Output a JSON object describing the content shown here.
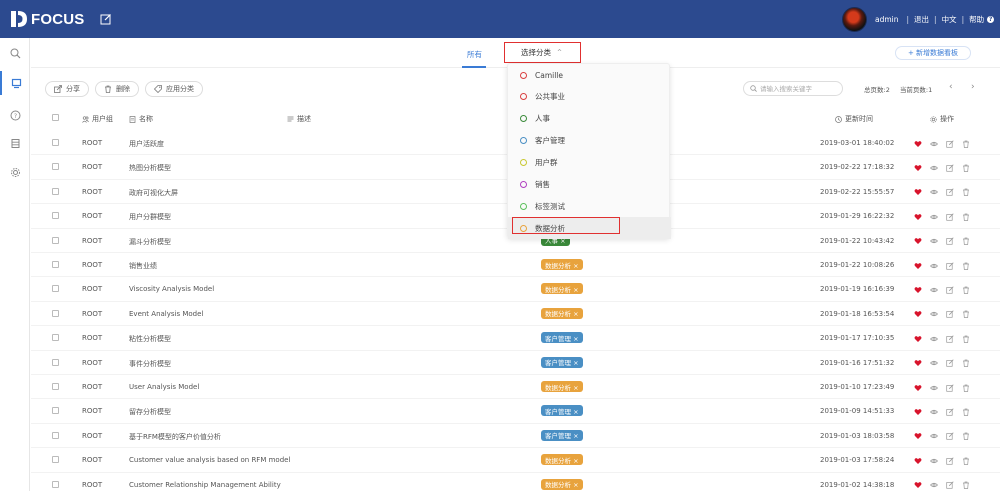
{
  "header": {
    "logo_text": "FOCUS",
    "user": "admin",
    "logout": "退出",
    "lang": "中文",
    "help": "帮助",
    "sep": "|"
  },
  "tabs": {
    "all": "所有",
    "select_category": "选择分类",
    "new_board": "+ 新增数据看板"
  },
  "actions": {
    "share": "分享",
    "delete": "删除",
    "apply_category": "应用分类"
  },
  "search": {
    "placeholder": "请输入搜索关键字"
  },
  "pager": {
    "total": "总页数:2",
    "current": "当前页数:1"
  },
  "table": {
    "headers": {
      "group": "用户组",
      "name": "名称",
      "desc": "描述",
      "updated": "更新时间",
      "ops": "操作"
    },
    "rows": [
      {
        "group": "ROOT",
        "name": "用户活跃度",
        "tag": "",
        "tag_color": "",
        "time": "2019-03-01 18:40:02"
      },
      {
        "group": "ROOT",
        "name": "热图分析模型",
        "tag": "",
        "tag_color": "",
        "time": "2019-02-22 17:18:32"
      },
      {
        "group": "ROOT",
        "name": "政府可视化大屏",
        "tag": "",
        "tag_color": "",
        "time": "2019-02-22 15:55:57"
      },
      {
        "group": "ROOT",
        "name": "用户分群模型",
        "tag": "",
        "tag_color": "",
        "time": "2019-01-29 16:22:32"
      },
      {
        "group": "ROOT",
        "name": "漏斗分析模型",
        "tag": "人事 ×",
        "tag_color": "#3a8a3a",
        "time": "2019-01-22 10:43:42"
      },
      {
        "group": "ROOT",
        "name": "销售业绩",
        "tag": "数据分析 ×",
        "tag_color": "#e8a33d",
        "time": "2019-01-22 10:08:26"
      },
      {
        "group": "ROOT",
        "name": "Viscosity Analysis Model",
        "tag": "数据分析 ×",
        "tag_color": "#e8a33d",
        "time": "2019-01-19 16:16:39"
      },
      {
        "group": "ROOT",
        "name": "Event Analysis Model",
        "tag": "数据分析 ×",
        "tag_color": "#e8a33d",
        "time": "2019-01-18 16:53:54"
      },
      {
        "group": "ROOT",
        "name": "粘性分析模型",
        "tag": "客户管理 ×",
        "tag_color": "#4a8fc4",
        "time": "2019-01-17 17:10:35"
      },
      {
        "group": "ROOT",
        "name": "事件分析模型",
        "tag": "客户管理 ×",
        "tag_color": "#4a8fc4",
        "time": "2019-01-16 17:51:32"
      },
      {
        "group": "ROOT",
        "name": "User Analysis Model",
        "tag": "数据分析 ×",
        "tag_color": "#e8a33d",
        "time": "2019-01-10 17:23:49"
      },
      {
        "group": "ROOT",
        "name": "留存分析模型",
        "tag": "客户管理 ×",
        "tag_color": "#4a8fc4",
        "time": "2019-01-09 14:51:33"
      },
      {
        "group": "ROOT",
        "name": "基于RFM模型的客户价值分析",
        "tag": "客户管理 ×",
        "tag_color": "#4a8fc4",
        "time": "2019-01-03 18:03:58"
      },
      {
        "group": "ROOT",
        "name": "Customer value analysis based on RFM model",
        "tag": "数据分析 ×",
        "tag_color": "#e8a33d",
        "time": "2019-01-03 17:58:24"
      },
      {
        "group": "ROOT",
        "name": "Customer Relationship Management Ability",
        "tag": "数据分析 ×",
        "tag_color": "#e8a33d",
        "time": "2019-01-02 14:38:18"
      }
    ]
  },
  "dropdown": {
    "items": [
      {
        "label": "Camille",
        "color": "#d94040"
      },
      {
        "label": "公共事业",
        "color": "#d94040"
      },
      {
        "label": "人事",
        "color": "#3a8a3a"
      },
      {
        "label": "客户管理",
        "color": "#4a8fc4"
      },
      {
        "label": "用户群",
        "color": "#c8c832"
      },
      {
        "label": "销售",
        "color": "#b040c0"
      },
      {
        "label": "标签测试",
        "color": "#5cc05c"
      },
      {
        "label": "数据分析",
        "color": "#e8a33d"
      }
    ]
  },
  "colors": {
    "header_bg": "#2c4a8f",
    "accent": "#3a7bd5",
    "heart": "#d8142c",
    "highlight_box": "#e03030"
  }
}
